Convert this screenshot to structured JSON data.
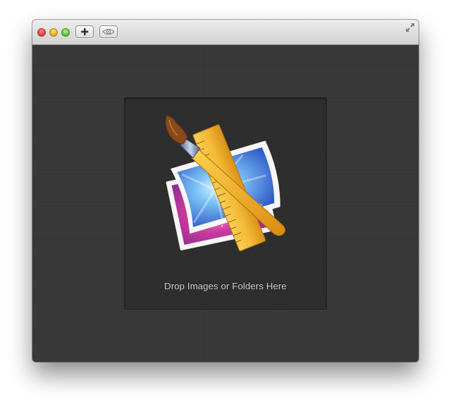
{
  "window": {
    "traffic_lights": [
      {
        "name": "close",
        "color": "#e0443e"
      },
      {
        "name": "minimize",
        "color": "#e8ad23"
      },
      {
        "name": "zoom",
        "color": "#64c33e"
      }
    ],
    "toolbar": {
      "add_icon": "plus-icon",
      "preview_icon": "eye-icon",
      "fullscreen_icon": "fullscreen-arrows-icon"
    }
  },
  "dropzone": {
    "label": "Drop Images or Folders Here",
    "icon": "photo-ruler-brush-icon"
  },
  "colors": {
    "background": "#383838",
    "dropzone": "#2e2e2e",
    "label": "#cfcfcf"
  }
}
